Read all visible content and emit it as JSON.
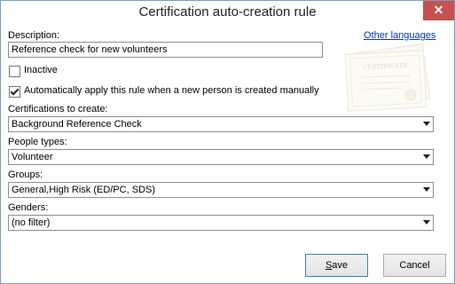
{
  "window": {
    "title": "Certification auto-creation rule",
    "close_glyph": "✕"
  },
  "description": {
    "label": "Description:",
    "value": "Reference check for new volunteers",
    "other_languages_link": "Other languages"
  },
  "inactive": {
    "label": "Inactive",
    "checked": false
  },
  "auto_apply": {
    "label": "Automatically apply this rule when a new person is created manually",
    "checked": true
  },
  "certifications": {
    "label": "Certifications to create:",
    "value": "Background Reference Check"
  },
  "people_types": {
    "label": "People types:",
    "value": "Volunteer"
  },
  "groups": {
    "label": "Groups:",
    "value": "General,High Risk (ED/PC, SDS)"
  },
  "genders": {
    "label": "Genders:",
    "value": "(no filter)"
  },
  "buttons": {
    "save": "Save",
    "cancel": "Cancel"
  },
  "decor": {
    "certificate_text": "CERTIFICATE"
  }
}
